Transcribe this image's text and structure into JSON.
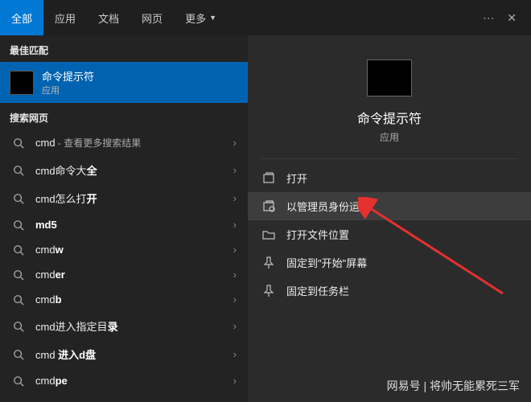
{
  "header": {
    "tabs": [
      "全部",
      "应用",
      "文档",
      "网页",
      "更多"
    ],
    "active_tab_index": 0
  },
  "sections": {
    "best_match": "最佳匹配",
    "search_web": "搜索网页"
  },
  "best_match_item": {
    "title": "命令提示符",
    "subtitle": "应用"
  },
  "search_items": [
    {
      "prefix": "cmd",
      "bold": "",
      "suffix": " - 查看更多搜索结果"
    },
    {
      "prefix": "cmd命令大",
      "bold": "全",
      "suffix": ""
    },
    {
      "prefix": "cmd怎么打",
      "bold": "开",
      "suffix": ""
    },
    {
      "prefix": "",
      "bold": "md5",
      "suffix": ""
    },
    {
      "prefix": "cmd",
      "bold": "w",
      "suffix": ""
    },
    {
      "prefix": "cmd",
      "bold": "er",
      "suffix": ""
    },
    {
      "prefix": "cmd",
      "bold": "b",
      "suffix": ""
    },
    {
      "prefix": "cmd进入指定目",
      "bold": "录",
      "suffix": ""
    },
    {
      "prefix": "cmd ",
      "bold": "进入d盘",
      "suffix": ""
    },
    {
      "prefix": "cmd",
      "bold": "pe",
      "suffix": ""
    }
  ],
  "detail": {
    "title": "命令提示符",
    "subtitle": "应用"
  },
  "actions": [
    {
      "icon": "open",
      "label": "打开",
      "highlighted": false
    },
    {
      "icon": "admin",
      "label": "以管理员身份运行",
      "highlighted": true
    },
    {
      "icon": "folder",
      "label": "打开文件位置",
      "highlighted": false
    },
    {
      "icon": "pin-start",
      "label": "固定到\"开始\"屏幕",
      "highlighted": false
    },
    {
      "icon": "pin-taskbar",
      "label": "固定到任务栏",
      "highlighted": false
    }
  ],
  "watermark": "网易号 | 将帅无能累死三军"
}
